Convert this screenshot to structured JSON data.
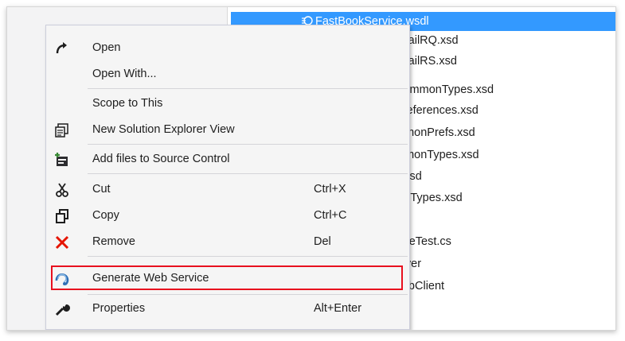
{
  "solution_explorer": {
    "files": [
      {
        "name": "FastBookService.wsdl",
        "selected": true
      },
      {
        "name": "AvailRQ.xsd"
      },
      {
        "name": "AvailRS.xsd"
      },
      {
        "name": "CommonTypes.xsd"
      },
      {
        "name": "Preferences.xsd"
      },
      {
        "name": "mmonPrefs.xsd"
      },
      {
        "name": "mmonTypes.xsd"
      },
      {
        "name": "s.xsd"
      },
      {
        "name": "pleTypes.xsd"
      },
      {
        "name": "viceTest.cs"
      },
      {
        "name": "erver"
      },
      {
        "name": "VebClient"
      }
    ]
  },
  "context_menu": {
    "items": [
      {
        "label": "Open",
        "shortcut": "",
        "icon": "open-arrow-icon"
      },
      {
        "label": "Open With...",
        "shortcut": "",
        "icon": ""
      },
      {
        "label": "Scope to This",
        "shortcut": "",
        "icon": ""
      },
      {
        "label": "New Solution Explorer View",
        "shortcut": "",
        "icon": "new-explorer-view-icon"
      },
      {
        "label": "Add files to Source Control",
        "shortcut": "",
        "icon": "add-source-control-icon"
      },
      {
        "label": "Cut",
        "shortcut": "Ctrl+X",
        "icon": "scissors-icon"
      },
      {
        "label": "Copy",
        "shortcut": "Ctrl+C",
        "icon": "copy-icon"
      },
      {
        "label": "Remove",
        "shortcut": "Del",
        "icon": "remove-x-icon"
      },
      {
        "label": "Generate Web Service",
        "shortcut": "",
        "icon": "web-service-icon",
        "highlighted": true
      },
      {
        "label": "Properties",
        "shortcut": "Alt+Enter",
        "icon": "wrench-icon"
      }
    ]
  },
  "colors": {
    "selection": "#3399ff",
    "highlight_border": "#e8101e",
    "remove_icon": "#e51400"
  }
}
